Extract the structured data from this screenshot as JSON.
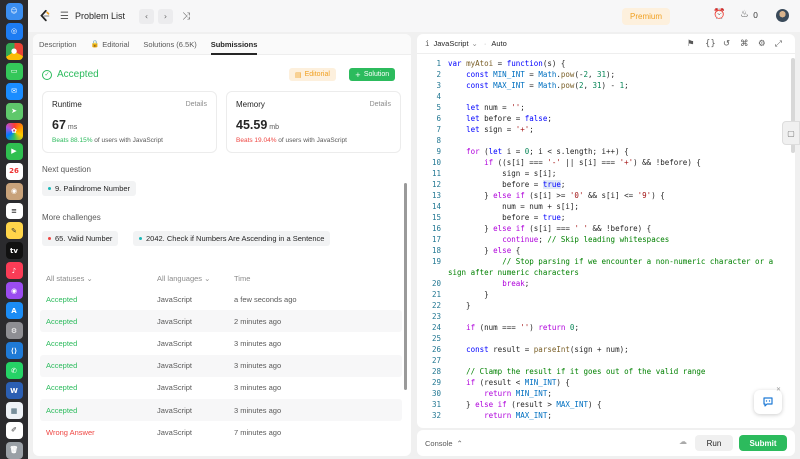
{
  "topbar": {
    "title": "Problem List",
    "premium": "Premium",
    "fire_count": "0"
  },
  "tabs": [
    {
      "label": "Description"
    },
    {
      "label": "Editorial"
    },
    {
      "label": "Solutions (6.5K)"
    },
    {
      "label": "Submissions"
    }
  ],
  "result": {
    "status": "Accepted",
    "editorial_btn": "Editorial",
    "solution_btn": "Solution"
  },
  "runtime": {
    "label": "Runtime",
    "details": "Details",
    "value": "67",
    "unit": "ms",
    "beats_pct": "Beats 88.15%",
    "beats_text": "of users with JavaScript"
  },
  "memory": {
    "label": "Memory",
    "details": "Details",
    "value": "45.59",
    "unit": "mb",
    "beats_pct": "Beats 19.04%",
    "beats_text": "of users with JavaScript"
  },
  "next_question": {
    "label": "Next question",
    "item": "9. Palindrome Number"
  },
  "more_challenges": {
    "label": "More challenges",
    "items": [
      "65. Valid Number",
      "2042. Check if Numbers Are Ascending in a Sentence"
    ]
  },
  "table": {
    "headers": [
      "All statuses",
      "All languages",
      "Time"
    ],
    "rows": [
      {
        "status": "Accepted",
        "lang": "JavaScript",
        "time": "a few seconds ago"
      },
      {
        "status": "Accepted",
        "lang": "JavaScript",
        "time": "2 minutes ago"
      },
      {
        "status": "Accepted",
        "lang": "JavaScript",
        "time": "3 minutes ago"
      },
      {
        "status": "Accepted",
        "lang": "JavaScript",
        "time": "3 minutes ago"
      },
      {
        "status": "Accepted",
        "lang": "JavaScript",
        "time": "3 minutes ago"
      },
      {
        "status": "Accepted",
        "lang": "JavaScript",
        "time": "3 minutes ago"
      },
      {
        "status": "Wrong Answer",
        "lang": "JavaScript",
        "time": "7 minutes ago"
      }
    ]
  },
  "editor": {
    "language": "JavaScript",
    "mode": "Auto"
  },
  "console": {
    "label": "Console",
    "run": "Run",
    "submit": "Submit"
  },
  "code_lines": [
    "var myAtoi = function(s) {",
    "    const MIN_INT = Math.pow(-2, 31);",
    "    const MAX_INT = Math.pow(2, 31) - 1;",
    "",
    "    let num = '';",
    "    let before = false;",
    "    let sign = '+';",
    "",
    "    for (let i = 0; i < s.length; i++) {",
    "        if ((s[i] === '-' || s[i] === '+') && !before) {",
    "            sign = s[i];",
    "            before = true;",
    "        } else if (s[i] >= '0' && s[i] <= '9') {",
    "            num = num + s[i];",
    "            before = true;",
    "        } else if (s[i] === ' ' && !before) {",
    "            continue; // Skip leading whitespaces",
    "        } else {",
    "            // Stop parsing if we encounter a non-numeric character or a",
    "sign after numeric characters",
    "            break;",
    "        }",
    "    }",
    "",
    "    if (num === '') return 0;",
    "",
    "    const result = parseInt(sign + num);",
    "",
    "    // Clamp the result if it goes out of the valid range",
    "    if (result < MIN_INT) {",
    "        return MIN_INT;",
    "    } else if (result > MAX_INT) {",
    "        return MAX_INT;"
  ],
  "line_numbers": [
    "1",
    "2",
    "3",
    "4",
    "5",
    "6",
    "7",
    "8",
    "9",
    "10",
    "11",
    "12",
    "13",
    "14",
    "15",
    "16",
    "17",
    "18",
    "19",
    "",
    "20",
    "21",
    "22",
    "23",
    "24",
    "25",
    "26",
    "27",
    "28",
    "29",
    "30",
    "31",
    "32"
  ]
}
